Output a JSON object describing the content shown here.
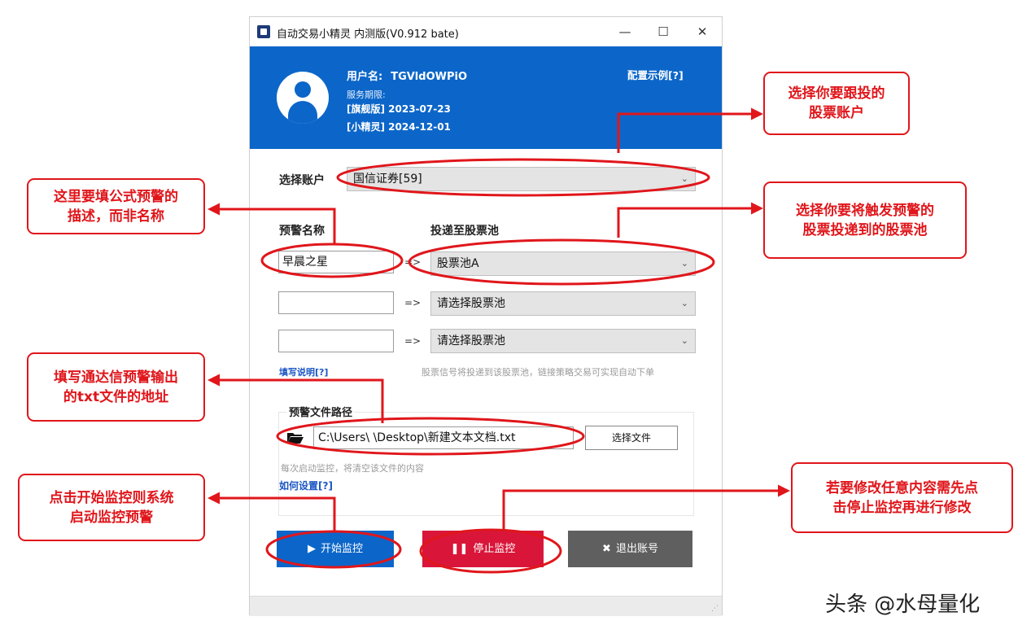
{
  "window": {
    "title": "自动交易小精灵 内测版(V0.912 bate)",
    "controls": {
      "minimize": "—",
      "maximize": "☐",
      "close": "✕"
    }
  },
  "header": {
    "username_label": "用户名:",
    "username": "TGVldOWPiO",
    "service_label": "服务期限:",
    "flagship": "[旗舰版] 2023-07-23",
    "mini": "[小精灵] 2024-12-01",
    "config_link": "配置示例[?]"
  },
  "account": {
    "label": "选择账户",
    "selected": "国信证券[59]"
  },
  "alerts": {
    "name_header": "预警名称",
    "pool_header": "投递至股票池",
    "arrow": "=>",
    "rows": [
      {
        "name": "早晨之星",
        "pool": "股票池A"
      },
      {
        "name": "",
        "pool": "请选择股票池"
      },
      {
        "name": "",
        "pool": "请选择股票池"
      }
    ],
    "help_link": "填写说明[?]",
    "hint": "股票信号将投递到该股票池，链接策略交易可实现自动下单"
  },
  "file": {
    "group_label": "预警文件路径",
    "path": "C:\\Users\\    \\Desktop\\新建文本文档.txt",
    "choose_button": "选择文件",
    "note": "每次启动监控，将清空该文件的内容",
    "howto_link": "如何设置[?]"
  },
  "buttons": {
    "start": "开始监控",
    "stop": "停止监控",
    "exit": "退出账号"
  },
  "glyphs": {
    "start": "▶",
    "stop": "❚❚",
    "exit": "✖",
    "chevron": "⌄",
    "grip": "⋰"
  },
  "annotations": {
    "select_account": "选择你要跟投的\n股票账户",
    "formula_desc": "这里要填公式预警的\n描述，而非名称",
    "select_pool": "选择你要将触发预警的\n股票投递到的股票池",
    "txt_path": "填写通达信预警输出\n的txt文件的地址",
    "start_monitor": "点击开始监控则系统\n启动监控预警",
    "stop_modify": "若要修改任意内容需先点\n击停止监控再进行修改"
  },
  "watermark": "头条 @水母量化",
  "colors": {
    "brand_blue": "#0c66c9",
    "stop_red": "#d9163a",
    "exit_gray": "#5f5f5f",
    "annotation_red": "#e0161b"
  }
}
